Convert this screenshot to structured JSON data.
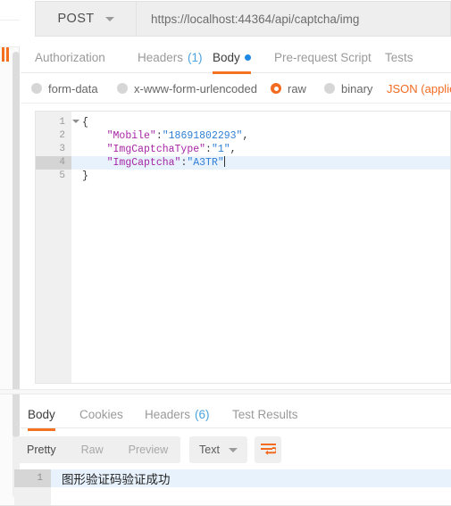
{
  "request": {
    "method": "POST",
    "url": "https://localhost:44364/api/captcha/img",
    "tabs": [
      {
        "label": "Authorization",
        "count": "",
        "active": false
      },
      {
        "label": "Headers",
        "count": "(1)",
        "active": false
      },
      {
        "label": "Body",
        "count": "",
        "active": true
      },
      {
        "label": "Pre-request Script",
        "count": "",
        "active": false
      },
      {
        "label": "Tests",
        "count": "",
        "active": false
      }
    ],
    "body_types": [
      {
        "label": "form-data",
        "selected": false
      },
      {
        "label": "x-www-form-urlencoded",
        "selected": false
      },
      {
        "label": "raw",
        "selected": true
      },
      {
        "label": "binary",
        "selected": false
      }
    ],
    "content_type": "JSON (applic",
    "editor": {
      "active_line": 4,
      "lines": [
        {
          "num": "1",
          "fold": true,
          "segments": [
            {
              "t": "{",
              "c": "punc"
            }
          ]
        },
        {
          "num": "2",
          "fold": false,
          "segments": [
            {
              "t": "    ",
              "c": "punc"
            },
            {
              "t": "\"Mobile\"",
              "c": "key"
            },
            {
              "t": ":",
              "c": "punc"
            },
            {
              "t": "\"18691802293\"",
              "c": "str"
            },
            {
              "t": ",",
              "c": "punc"
            }
          ]
        },
        {
          "num": "3",
          "fold": false,
          "segments": [
            {
              "t": "    ",
              "c": "punc"
            },
            {
              "t": "\"ImgCaptchaType\"",
              "c": "key"
            },
            {
              "t": ":",
              "c": "punc"
            },
            {
              "t": "\"1\"",
              "c": "str"
            },
            {
              "t": ",",
              "c": "punc"
            }
          ]
        },
        {
          "num": "4",
          "fold": false,
          "segments": [
            {
              "t": "    ",
              "c": "punc"
            },
            {
              "t": "\"ImgCaptcha\"",
              "c": "key"
            },
            {
              "t": ":",
              "c": "punc"
            },
            {
              "t": "\"A3TR\"",
              "c": "str"
            }
          ],
          "caret": true
        },
        {
          "num": "5",
          "fold": false,
          "segments": [
            {
              "t": "}",
              "c": "punc"
            }
          ]
        }
      ]
    }
  },
  "response": {
    "tabs": [
      {
        "label": "Body",
        "count": "",
        "active": true
      },
      {
        "label": "Cookies",
        "count": "",
        "active": false
      },
      {
        "label": "Headers",
        "count": "(6)",
        "active": false
      },
      {
        "label": "Test Results",
        "count": "",
        "active": false
      }
    ],
    "view_modes": [
      {
        "label": "Pretty",
        "active": true
      },
      {
        "label": "Raw",
        "active": false
      },
      {
        "label": "Preview",
        "active": false
      }
    ],
    "format": "Text",
    "wrap_icon": "word-wrap-icon",
    "body": {
      "line_number": "1",
      "text": "图形验证码验证成功"
    }
  },
  "colors": {
    "accent_orange": "#f47321",
    "link_blue": "#4aa3df",
    "dot_blue": "#1e88e5",
    "json_key": "#a626a4",
    "json_string": "#2f7fd6",
    "active_line": "#e8f2fd"
  }
}
